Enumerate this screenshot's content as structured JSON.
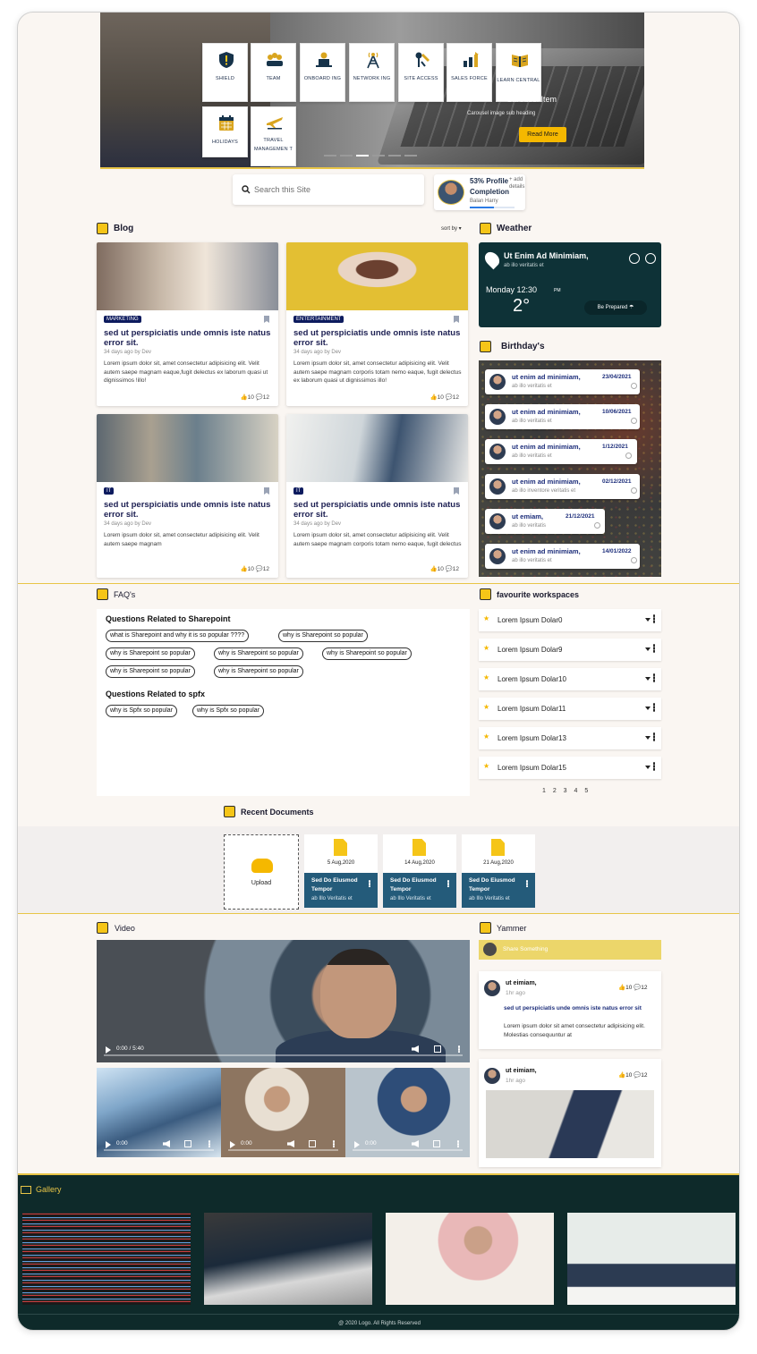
{
  "hero": {
    "tiles": [
      {
        "icon": "shield-icon",
        "label": "SHIELD"
      },
      {
        "icon": "team-icon",
        "label": "TEAM"
      },
      {
        "icon": "onboarding-icon",
        "label": "ONBOARD ING"
      },
      {
        "icon": "network-tower-icon",
        "label": "NETWORK ING"
      },
      {
        "icon": "site-access-icon",
        "label": "SITE ACCESS"
      },
      {
        "icon": "sales-chart-icon",
        "label": "SALES FORCE"
      },
      {
        "icon": "book-icon",
        "label": "LEARN CENTRAL"
      },
      {
        "icon": "calendar-icon",
        "label": "HOLIDAYS"
      },
      {
        "icon": "airplane-icon",
        "label": "TRAVEL MANAGEMEN T"
      }
    ],
    "carousel_title": "Carousel Item",
    "carousel_subtitle": "Carousel image sub heading",
    "read_more": "Read More"
  },
  "search": {
    "placeholder": "Search this Site"
  },
  "profile": {
    "completion": "53% Profile Completion",
    "add": "+ add details",
    "name": "Balan Harry",
    "progress_pct": 53
  },
  "blog": {
    "title": "Blog",
    "sort_label": "sort by",
    "cards": [
      {
        "tag": "MARKETING",
        "title": "sed ut perspiciatis unde omnis iste natus error sit.",
        "meta": "34 days ago by Dev",
        "body": "Lorem ipsum dolor sit, amet consectetur adipisicing elit. Velit autem saepe magnam eaque,fugit delectus ex laborum quasi ut dignissimos !illo!",
        "likes": "10",
        "comments": "12"
      },
      {
        "tag": "ENTERTAINMENT",
        "title": "sed ut perspiciatis unde omnis iste natus error sit.",
        "meta": "34 days ago by Dev",
        "body": "Lorem ipsum dolor sit, amet consectetur adipisicing elit. Velit autem saepe magnam corporis totam nemo eaque, fugit delectus ex laborum quasi ut dignissimos illo!",
        "likes": "10",
        "comments": "12"
      },
      {
        "tag": "IT",
        "title": "sed ut perspiciatis unde omnis iste natus error sit.",
        "meta": "34 days ago by Dev",
        "body": "Lorem ipsum dolor sit, amet consectetur adipisicing elit. Velit autem saepe magnam",
        "likes": "10",
        "comments": "12"
      },
      {
        "tag": "IT",
        "title": "sed ut perspiciatis unde omnis iste natus error sit.",
        "meta": "34 days ago by Dev",
        "body": "Lorem ipsum dolor sit, amet consectetur adipisicing elit. Velit autem saepe magnam corporis totam nemo eaque, fugit delectus",
        "likes": "10",
        "comments": "12"
      }
    ]
  },
  "weather": {
    "title": "Weather",
    "location": "Ut Enim Ad Minimiam,",
    "sub": "ab illo veritatis et",
    "day": "Monday 12:30",
    "ampm": "PM",
    "temp": "2°",
    "prepared": "Be Prepared"
  },
  "birthdays": {
    "title": "Birthday's",
    "items": [
      {
        "name": "ut enim ad minimiam,",
        "sub": "ab illo veritatis et",
        "date": "23/04/2021"
      },
      {
        "name": "ut enim ad minimiam,",
        "sub": "ab illo veritatis et",
        "date": "10/06/2021"
      },
      {
        "name": "ut enim ad minimiam,",
        "sub": "ab illo veritatis et",
        "date": "1/12/2021"
      },
      {
        "name": "ut enim ad minimiam,",
        "sub": "ab illo inventore veritatis et",
        "date": "02/12/2021"
      },
      {
        "name": "ut emiam,",
        "sub": "ab illo veritatis",
        "date": "21/12/2021"
      },
      {
        "name": "ut enim ad minimiam,",
        "sub": "ab illo veritatis et",
        "date": "14/01/2022"
      }
    ]
  },
  "faq": {
    "title": "FAQ's",
    "groups": [
      {
        "heading": "Questions Related to Sharepoint",
        "chips": [
          "what is Sharepoint and why it is so popular ????",
          "why is Sharepoint so popular",
          "why is Sharepoint so popular",
          "why is Sharepoint so popular",
          "why is Sharepoint so popular",
          "why is Sharepoint so popular",
          "why is Sharepoint so popular"
        ]
      },
      {
        "heading": "Questions Related to spfx",
        "chips": [
          "why is Spfx so popular",
          "why is Spfx so popular"
        ]
      }
    ]
  },
  "workspaces": {
    "title": "favourite workspaces",
    "items": [
      "Lorem Ipsum Dolar0",
      "Lorem Ipsum Dolar9",
      "Lorem Ipsum Dolar10",
      "Lorem Ipsum Dolar11",
      "Lorem Ipsum Dolar13",
      "Lorem Ipsum Dolar15"
    ],
    "pages": "1 2 3 4 5"
  },
  "documents": {
    "title": "Recent Documents",
    "upload": "Upload",
    "items": [
      {
        "date": "5 Aug,2020",
        "name": "Sed Do Eiusmod Tempor",
        "sub": "ab Illo Veritatis et"
      },
      {
        "date": "14 Aug,2020",
        "name": "Sed Do Eiusmod Tempor",
        "sub": "ab Illo Veritatis et"
      },
      {
        "date": "21 Aug,2020",
        "name": "Sed Do Eiusmod Tempor",
        "sub": "ab Illo Veritatis et"
      }
    ]
  },
  "video": {
    "title": "Video",
    "main_time": "0:00 / 5:40",
    "thumb_time": "0:00"
  },
  "yammer": {
    "title": "Yammer",
    "share_placeholder": "Share Something",
    "posts": [
      {
        "name": "ut eimiam,",
        "time": "1hr ago",
        "likes": "10",
        "comments": "12",
        "title": "sed ut perspiciatis unde omnis iste natus error sit",
        "body": "Lorem ipsum dolor sit amet consectetur adipisicing elit. Molestias consequuntur at"
      },
      {
        "name": "ut eimiam,",
        "time": "1hr ago",
        "likes": "10",
        "comments": "12"
      }
    ]
  },
  "gallery": {
    "title": "Gallery"
  },
  "footer": {
    "text": "@ 2020 Logo. All Rights Reserved"
  },
  "colors": {
    "accent": "#f5c518",
    "dark_teal": "#0e2a2a",
    "navy": "#1c2d7a",
    "doc_blue": "#245b7a"
  }
}
